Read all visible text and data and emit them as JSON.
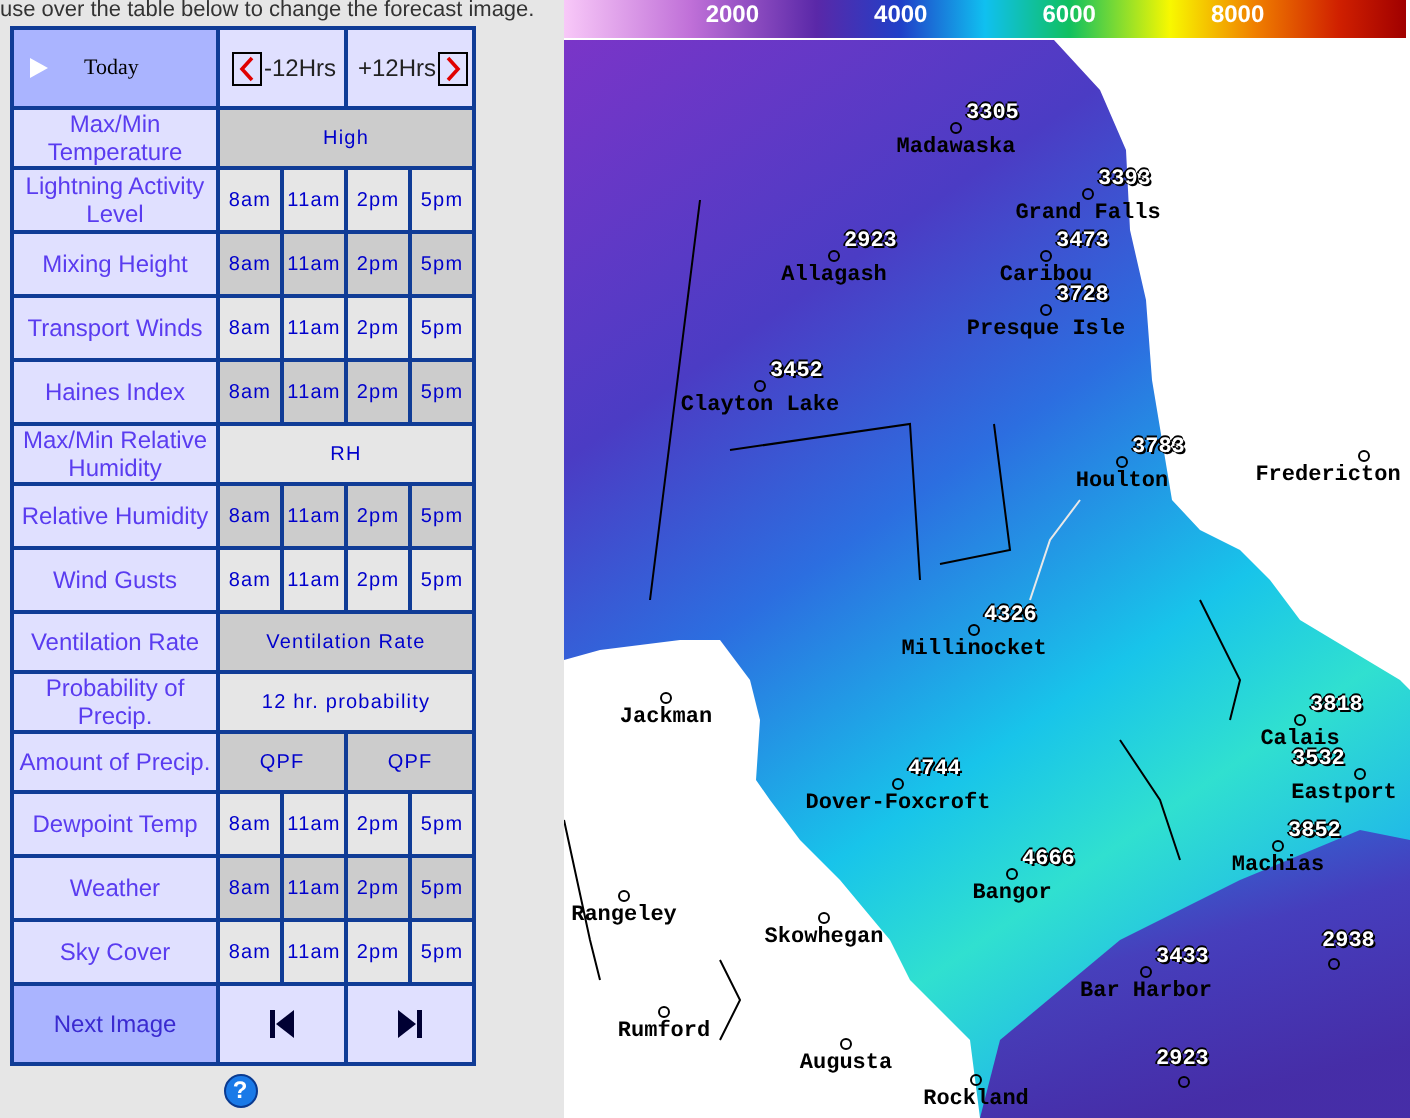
{
  "intro": "use over the table below to change the forecast image.",
  "header": {
    "today": "Today",
    "prev": "-12Hrs",
    "next": "+12Hrs"
  },
  "rows": [
    {
      "label": "Max/Min Temperature",
      "kind": "single",
      "shaded": true,
      "cells": [
        "High"
      ]
    },
    {
      "label": "Lightning Activity Level",
      "kind": "times",
      "shaded": false,
      "cells": [
        "8am",
        "11am",
        "2pm",
        "5pm"
      ]
    },
    {
      "label": "Mixing Height",
      "kind": "times",
      "shaded": true,
      "cells": [
        "8am",
        "11am",
        "2pm",
        "5pm"
      ]
    },
    {
      "label": "Transport Winds",
      "kind": "times",
      "shaded": false,
      "cells": [
        "8am",
        "11am",
        "2pm",
        "5pm"
      ]
    },
    {
      "label": "Haines Index",
      "kind": "times",
      "shaded": true,
      "cells": [
        "8am",
        "11am",
        "2pm",
        "5pm"
      ]
    },
    {
      "label": "Max/Min Relative Humidity",
      "kind": "single",
      "shaded": false,
      "cells": [
        "RH"
      ]
    },
    {
      "label": "Relative Humidity",
      "kind": "times",
      "shaded": true,
      "cells": [
        "8am",
        "11am",
        "2pm",
        "5pm"
      ]
    },
    {
      "label": "Wind Gusts",
      "kind": "times",
      "shaded": false,
      "cells": [
        "8am",
        "11am",
        "2pm",
        "5pm"
      ]
    },
    {
      "label": "Ventilation Rate",
      "kind": "single",
      "shaded": true,
      "cells": [
        "Ventilation Rate"
      ]
    },
    {
      "label": "Probability of Precip.",
      "kind": "single",
      "shaded": false,
      "cells": [
        "12 hr. probability"
      ]
    },
    {
      "label": "Amount of Precip.",
      "kind": "pair",
      "shaded": true,
      "cells": [
        "QPF",
        "QPF"
      ]
    },
    {
      "label": "Dewpoint Temp",
      "kind": "times",
      "shaded": false,
      "cells": [
        "8am",
        "11am",
        "2pm",
        "5pm"
      ]
    },
    {
      "label": "Weather",
      "kind": "times",
      "shaded": true,
      "cells": [
        "8am",
        "11am",
        "2pm",
        "5pm"
      ]
    },
    {
      "label": "Sky Cover",
      "kind": "times",
      "shaded": false,
      "cells": [
        "8am",
        "11am",
        "2pm",
        "5pm"
      ]
    }
  ],
  "footer": {
    "label": "Next Image"
  },
  "help": "?",
  "map": {
    "colorbar_ticks": [
      "2000",
      "4000",
      "6000",
      "8000"
    ],
    "stations": [
      {
        "name": "Madawaska",
        "value": "3305"
      },
      {
        "name": "Grand Falls",
        "value": "3393"
      },
      {
        "name": "Allagash",
        "value": "2923"
      },
      {
        "name": "Caribou",
        "value": "3473"
      },
      {
        "name": "Presque Isle",
        "value": "3728"
      },
      {
        "name": "Clayton Lake",
        "value": "3452"
      },
      {
        "name": "Houlton",
        "value": "3783"
      },
      {
        "name": "Fredericton"
      },
      {
        "name": "Millinocket",
        "value": "4326"
      },
      {
        "name": "Jackman"
      },
      {
        "name": "Dover-Foxcroft",
        "value": "4744"
      },
      {
        "name": "Calais",
        "value": "3818"
      },
      {
        "name": "Eastport",
        "value": "3532"
      },
      {
        "name": "Machias",
        "value": "3852"
      },
      {
        "name": "Bangor",
        "value": "4666"
      },
      {
        "name": "Rangeley"
      },
      {
        "name": "Skowhegan"
      },
      {
        "value": "2938"
      },
      {
        "name": "Bar Harbor",
        "value": "3433"
      },
      {
        "name": "Rumford"
      },
      {
        "name": "Augusta"
      },
      {
        "value": "2923"
      },
      {
        "name": "Rockland"
      }
    ]
  }
}
